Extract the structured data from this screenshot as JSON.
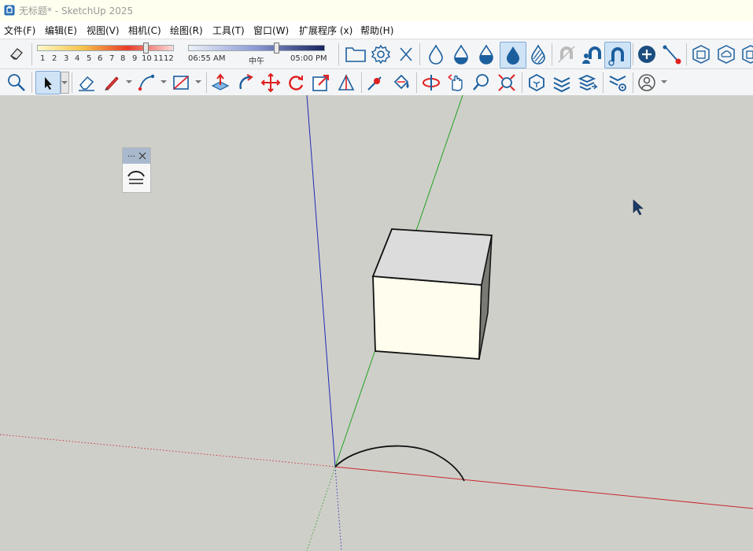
{
  "window": {
    "title": "无标题* - SketchUp 2025"
  },
  "menu": [
    {
      "label": "文件(F)"
    },
    {
      "label": "编辑(E)"
    },
    {
      "label": "视图(V)"
    },
    {
      "label": "相机(C)"
    },
    {
      "label": "绘图(R)"
    },
    {
      "label": "工具(T)"
    },
    {
      "label": "窗口(W)"
    },
    {
      "label": "扩展程序 (x)"
    },
    {
      "label": "帮助(H)"
    }
  ],
  "shadow_settings": {
    "month_ticks": [
      "1",
      "2",
      "3",
      "4",
      "5",
      "6",
      "7",
      "8",
      "9",
      "10",
      "11",
      "12"
    ],
    "month_value_fraction": 0.8,
    "time_start": "06:55 AM",
    "time_mid": "中午",
    "time_end": "05:00 PM",
    "time_value_fraction": 0.65
  },
  "toolbar1_icons": [
    "eraser-style-icon",
    "folder-icon",
    "gear-icon",
    "close-x-icon",
    "drop-outline-icon",
    "drop-half-icon",
    "drop-fill-icon",
    "drop-selected-icon",
    "drop-striped-icon",
    "magnet-off-icon",
    "magnet-user-icon",
    "magnet-active-icon",
    "add-circle-icon",
    "line-point-icon",
    "box-face-icon",
    "box-cloud-icon",
    "box-partial-icon"
  ],
  "toolbar2_icons": [
    "zoom-icon",
    "select-arrow-icon",
    "eraser-icon",
    "pencil-icon",
    "arc-icon",
    "rectangle-icon",
    "push-pull-icon",
    "follow-me-icon",
    "move-icon",
    "rotate-icon",
    "scale-icon",
    "protractor-icon",
    "tape-point-icon",
    "paint-bucket-icon",
    "orbit-icon",
    "pan-icon",
    "zoom-lens-icon",
    "zoom-extents-icon",
    "warehouse-icon",
    "layers-icon",
    "layers-arrow-icon",
    "extension-gear-icon",
    "account-icon"
  ],
  "colors": {
    "background": "#cfcfca",
    "axis_blue": "#1f2bb4",
    "axis_green": "#21a31f",
    "axis_red": "#c8282b",
    "box_face": "#fffded",
    "box_top": "#dcdcdc",
    "box_side": "#7a7a74",
    "accent": "#1e6fb8"
  }
}
